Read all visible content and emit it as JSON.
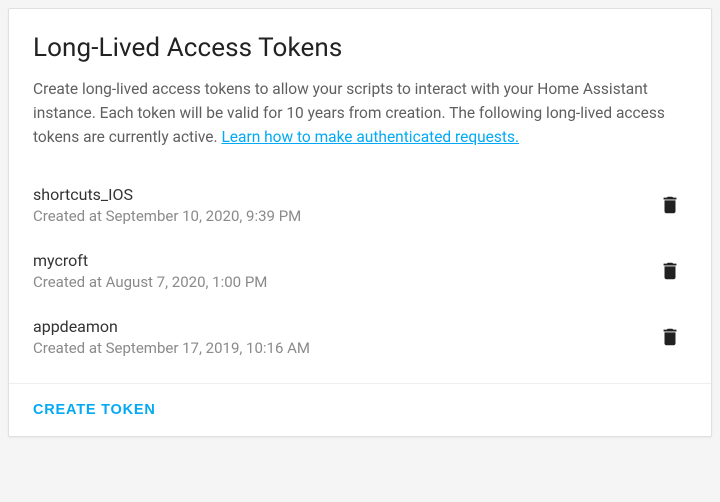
{
  "title": "Long-Lived Access Tokens",
  "description": "Create long-lived access tokens to allow your scripts to interact with your Home Assistant instance. Each token will be valid for 10 years from creation. The following long-lived access tokens are currently active. ",
  "learn_link": "Learn how to make authenticated requests.",
  "tokens": [
    {
      "name": "shortcuts_IOS",
      "created": "Created at September 10, 2020, 9:39 PM"
    },
    {
      "name": "mycroft",
      "created": "Created at August 7, 2020, 1:00 PM"
    },
    {
      "name": "appdeamon",
      "created": "Created at September 17, 2019, 10:16 AM"
    }
  ],
  "create_button": "CREATE TOKEN"
}
